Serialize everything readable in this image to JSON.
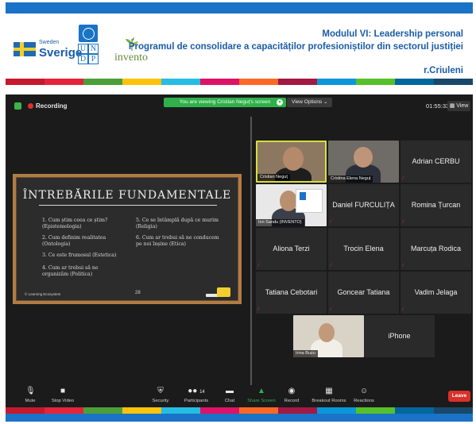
{
  "header": {
    "sweden_small": "Sweden",
    "sweden_big": "Sverige",
    "undp_letters": [
      "U",
      "N",
      "D",
      "P"
    ],
    "invento": "invento",
    "title": "Modulul VI: Leadership personal",
    "subtitle": "Programul de consolidare a capacităților profesioniștilor din sectorul justiției",
    "location": "r.Criuleni"
  },
  "colors": {
    "brand_blue": "#1a73c6",
    "stripe": [
      "#c5192d",
      "#e5243b",
      "#4c9f38",
      "#fcc30b",
      "#26bde2",
      "#dd1367",
      "#fd6925",
      "#a21942",
      "#0a97d9",
      "#56c02b",
      "#00689d",
      "#19486a"
    ]
  },
  "zoom": {
    "recording_label": "Recording",
    "viewing_banner": "You are viewing Cristian Neguț's screen",
    "view_options": "View Options",
    "clock": "01:55:33",
    "view_button": "View"
  },
  "slide": {
    "title": "ÎNTREBĂRILE FUNDAMENTALE",
    "questions_left": [
      "1. Cum știm ceea ce știm? (Epistemologia)",
      "2. Cum definim realitatea (Ontologia)",
      "3. Ce este frumosul (Estetica)",
      "4. Cum ar trebui să ne organizăm (Politica)"
    ],
    "questions_right": [
      "5. Ce se întâmplă după ce murim (Religia)",
      "6. Cum ar trebui să ne conducem pe noi înșine (Etica)"
    ],
    "footer": "© Learning Ecosystem",
    "page_number": "28"
  },
  "participants": [
    {
      "name": "Cristian Neguț",
      "video": true
    },
    {
      "name": "Cristina Elena Neguț",
      "video": true
    },
    {
      "name": "Adrian CERBU",
      "video": false
    },
    {
      "name": "Ion Sandu (INVENTO)",
      "video": true
    },
    {
      "name": "Daniel FURCULIȚA",
      "video": false
    },
    {
      "name": "Romina Țurcan",
      "video": false
    },
    {
      "name": "Aliona Terzi",
      "video": false
    },
    {
      "name": "Trocin Elena",
      "video": false
    },
    {
      "name": "Marcuța Rodica",
      "video": false
    },
    {
      "name": "Tatiana Cebotari",
      "video": false
    },
    {
      "name": "Goncear Tatiana",
      "video": false
    },
    {
      "name": "Vadim Jelaga",
      "video": false
    },
    {
      "name": "Irina Buzu",
      "video": true
    },
    {
      "name": "iPhone",
      "video": false
    }
  ],
  "toolbar": {
    "mute": "Mute",
    "stop_video": "Stop Video",
    "security": "Security",
    "participants": "Participants",
    "participants_count": "14",
    "chat": "Chat",
    "share_screen": "Share Screen",
    "record": "Record",
    "breakout": "Breakout Rooms",
    "reactions": "Reactions",
    "leave": "Leave"
  }
}
